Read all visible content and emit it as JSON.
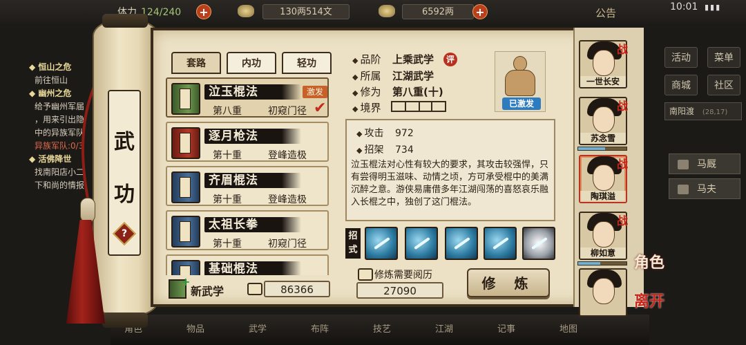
{
  "topbar": {
    "stamina_label": "体力",
    "stamina_value": "124/240",
    "money_silver": "130两514文",
    "money_gold": "6592两",
    "notice": "公告",
    "clock": "10:01",
    "plus": "+"
  },
  "quests": [
    {
      "title": "恒山之危",
      "desc": [
        "前往恒山"
      ]
    },
    {
      "title": "幽州之危",
      "desc": [
        "给予幽州军届",
        "，用来引出隐",
        "中的异族军队",
        "异族军队:0/3"
      ]
    },
    {
      "title": "活佛降世",
      "desc": [
        "找南阳店小二",
        "下和尚的情报"
      ]
    }
  ],
  "right_menu": {
    "buttons": [
      "活动",
      "菜单",
      "商城",
      "社区"
    ],
    "location": "南阳渡",
    "coords": "(28,17)",
    "entries": [
      "马厩",
      "马夫"
    ]
  },
  "bottom_bar": [
    "角色",
    "物品",
    "武学",
    "布阵",
    "技艺",
    "江湖",
    "记事",
    "地图"
  ],
  "scroll": {
    "title_chars": [
      "武",
      "功"
    ],
    "help": "?"
  },
  "tabs": [
    {
      "label": "套路",
      "active": true
    },
    {
      "label": "内功",
      "active": false
    },
    {
      "label": "轻功",
      "active": false
    }
  ],
  "skills": [
    {
      "name": "泣玉棍法",
      "level": "第八重",
      "rank": "初窥门径",
      "book": "green",
      "badge": "激发",
      "checked": true,
      "selected": true
    },
    {
      "name": "逐月枪法",
      "level": "第十重",
      "rank": "登峰造极",
      "book": "red",
      "badge": "",
      "checked": false,
      "selected": false
    },
    {
      "name": "齐眉棍法",
      "level": "第十重",
      "rank": "登峰造极",
      "book": "blue",
      "badge": "",
      "checked": false,
      "selected": false
    },
    {
      "name": "太祖长拳",
      "level": "第十重",
      "rank": "初窥门径",
      "book": "blue",
      "badge": "",
      "checked": false,
      "selected": false
    },
    {
      "name": "基础棍法",
      "level": "",
      "rank": "",
      "book": "blue",
      "badge": "",
      "checked": false,
      "selected": false
    }
  ],
  "new_skill": {
    "label": "新武学",
    "points": "86366"
  },
  "detail": {
    "grade_label": "品阶",
    "grade_value": "上乘武学",
    "ping": "评",
    "faction_label": "所属",
    "faction_value": "江湖武学",
    "cultivation_label": "修为",
    "cultivation_value": "第八重(十)",
    "realm_label": "境界",
    "portrait_label": "已激发",
    "attack_label": "攻击",
    "attack_value": "972",
    "parry_label": "招架",
    "parry_value": "734",
    "description": "泣玉棍法对心性有较大的要求，其攻击较强悍，只有尝得明玉滋味、动情之顷，方可承受棍中的美满沉醉之意。游侠易庸借多年江湖闯荡的喜怒哀乐融入长棍之中，独创了这门棍法。",
    "moves_label": "招式",
    "moves": [
      "move-1",
      "move-2",
      "move-3",
      "move-4",
      "move-5"
    ],
    "train_req_label": "修炼需要阅历",
    "train_req_value": "27090",
    "train_button": "修 炼"
  },
  "characters": [
    {
      "name": "一世长安",
      "tag": "战",
      "selected": false
    },
    {
      "name": "苏念雪",
      "tag": "战",
      "selected": false
    },
    {
      "name": "陶琪溢",
      "tag": "战",
      "selected": true
    },
    {
      "name": "柳如意",
      "tag": "战",
      "selected": false
    },
    {
      "name": "",
      "tag": "",
      "selected": false
    }
  ],
  "side_tags": {
    "role": "角色",
    "leave": "离开"
  },
  "colors": {
    "parchment": "#ece1c5",
    "ink": "#2a1f14",
    "accent_red": "#c7261a",
    "activated_blue": "#2d7cc0"
  }
}
